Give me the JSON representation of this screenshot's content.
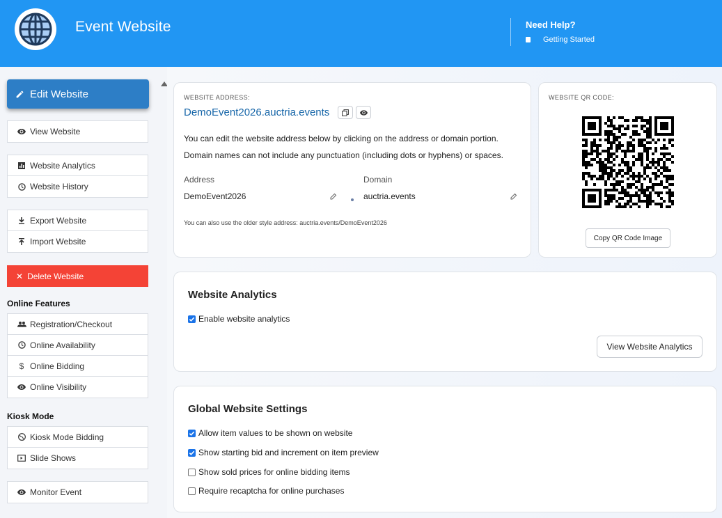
{
  "header": {
    "title": "Event Website",
    "help_title": "Need Help?",
    "help_link": "Getting Started",
    "brand_color": "#2196f3"
  },
  "sidebar": {
    "edit_label": "Edit Website",
    "view_label": "View Website",
    "analytics_label": "Website Analytics",
    "history_label": "Website History",
    "export_label": "Export Website",
    "import_label": "Import Website",
    "delete_label": "Delete Website",
    "online_heading": "Online Features",
    "online_items": [
      "Registration/Checkout",
      "Online Availability",
      "Online Bidding",
      "Online Visibility"
    ],
    "kiosk_heading": "Kiosk Mode",
    "kiosk_items": [
      "Kiosk Mode Bidding",
      "Slide Shows"
    ],
    "monitor_label": "Monitor Event",
    "delete_color": "#f44336",
    "edit_color": "#2d7ec6"
  },
  "address_card": {
    "label": "WEBSITE ADDRESS:",
    "address": "DemoEvent2026.auctria.events",
    "info1": "You can edit the website address below by clicking on the address or domain portion.",
    "info2": "Domain names can not include any punctuation (including dots or hyphens) or spaces.",
    "address_label": "Address",
    "address_value": "DemoEvent2026",
    "domain_label": "Domain",
    "domain_value": "auctria.events",
    "older_note": "You can also use the older style address: auctria.events/DemoEvent2026"
  },
  "qr_card": {
    "label": "WEBSITE QR CODE:",
    "copy_label": "Copy QR Code Image"
  },
  "analytics_card": {
    "title": "Website Analytics",
    "enable_label": "Enable website analytics",
    "enable_checked": true,
    "view_button": "View Website Analytics"
  },
  "global_card": {
    "title": "Global Website Settings",
    "options": [
      {
        "label": "Allow item values to be shown on website",
        "checked": true
      },
      {
        "label": "Show starting bid and increment on item preview",
        "checked": true
      },
      {
        "label": "Show sold prices for online bidding items",
        "checked": false
      },
      {
        "label": "Require recaptcha for online purchases",
        "checked": false
      }
    ]
  }
}
